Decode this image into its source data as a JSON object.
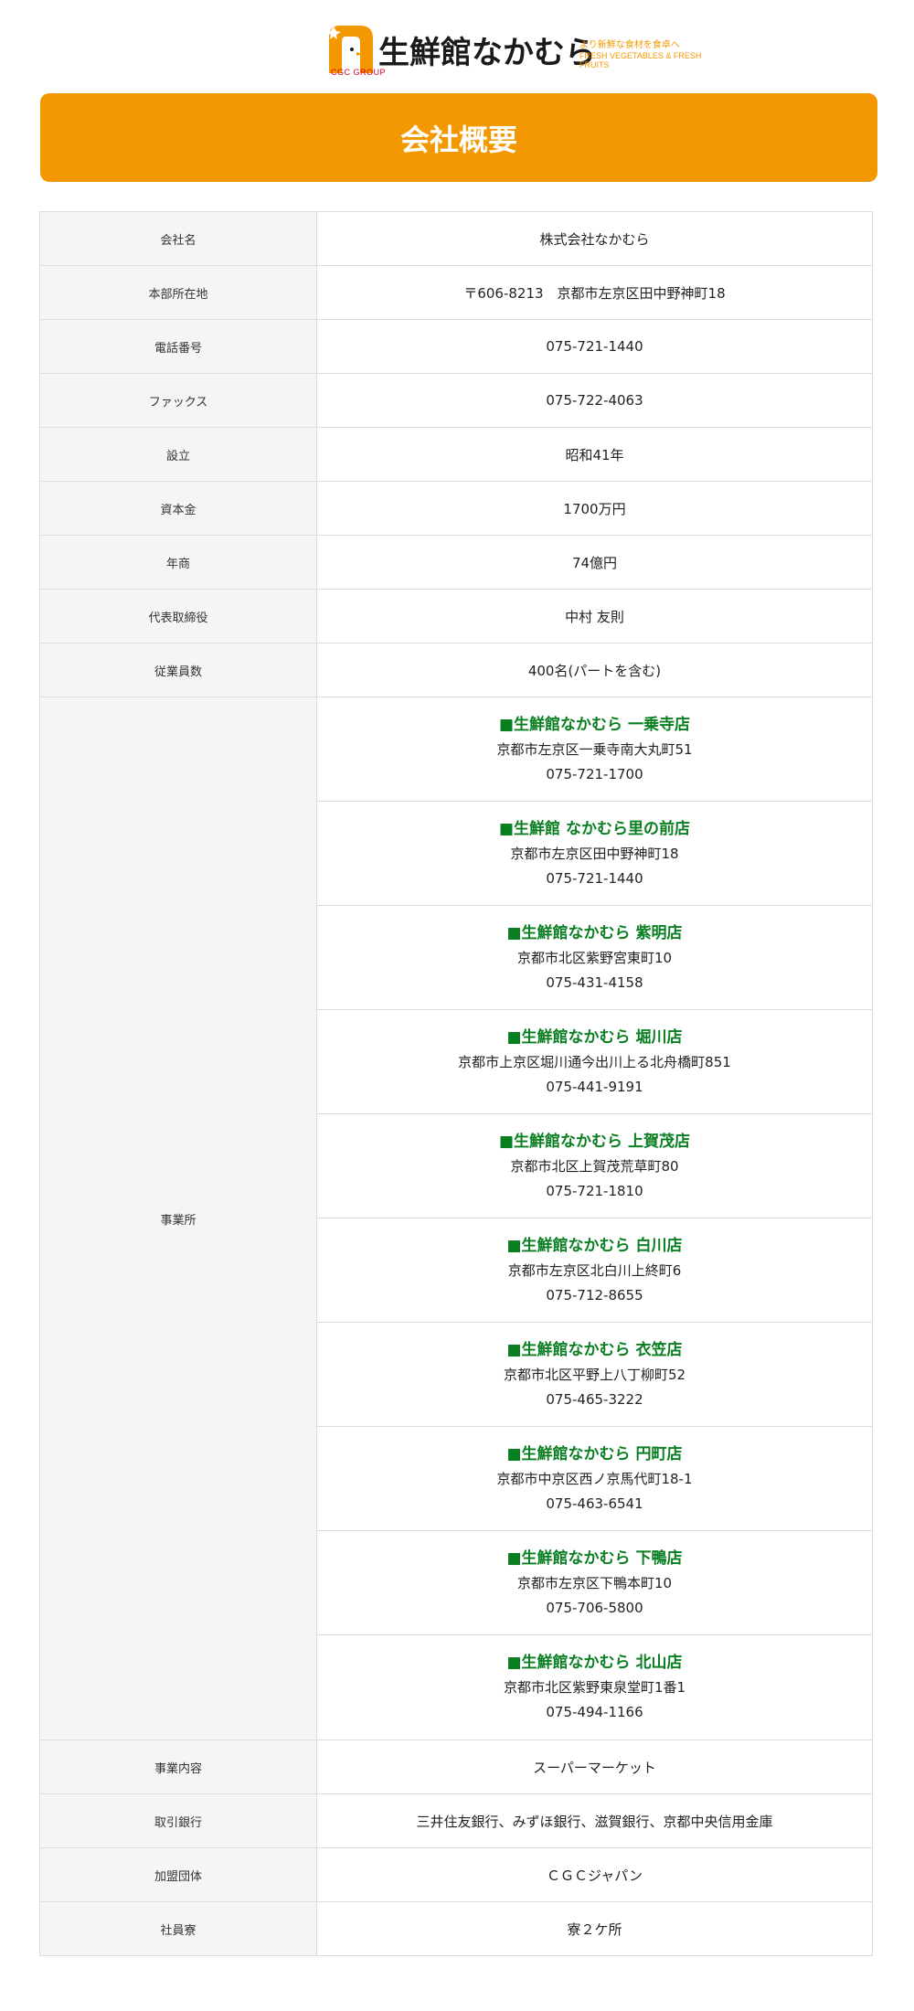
{
  "logo": {
    "name": "生鮮館なかむら",
    "group": "CGC GROUP",
    "tagline": "より新鮮な食材を食卓へ",
    "tagline_en": "FRESH VEGETABLES & FRESH FRUITS",
    "brand_color": "#f39800"
  },
  "page_title": "会社概要",
  "rows_top": [
    {
      "label": "会社名",
      "value": "株式会社なかむら"
    },
    {
      "label": "本部所在地",
      "value": "〒606-8213　京都市左京区田中野神町18"
    },
    {
      "label": "電話番号",
      "value": "075-721-1440"
    },
    {
      "label": "ファックス",
      "value": "075-722-4063"
    },
    {
      "label": "設立",
      "value": "昭和41年"
    },
    {
      "label": "資本金",
      "value": "1700万円"
    },
    {
      "label": "年商",
      "value": "74億円"
    },
    {
      "label": "代表取締役",
      "value": "中村 友則"
    },
    {
      "label": "従業員数",
      "value": "400名(パートを含む)"
    }
  ],
  "offices": {
    "label": "事業所",
    "stores": [
      {
        "name": "■生鮮館なかむら 一乗寺店",
        "address": "京都市左京区一乗寺南大丸町51",
        "tel": "075-721-1700"
      },
      {
        "name": "■生鮮館 なかむら里の前店",
        "address": "京都市左京区田中野神町18",
        "tel": "075-721-1440"
      },
      {
        "name": "■生鮮館なかむら 紫明店",
        "address": "京都市北区紫野宮東町10",
        "tel": "075-431-4158"
      },
      {
        "name": "■生鮮館なかむら 堀川店",
        "address": "京都市上京区堀川通今出川上る北舟橋町851",
        "tel": "075-441-9191"
      },
      {
        "name": "■生鮮館なかむら 上賀茂店",
        "address": "京都市北区上賀茂荒草町80",
        "tel": "075-721-1810"
      },
      {
        "name": "■生鮮館なかむら 白川店",
        "address": "京都市左京区北白川上終町6",
        "tel": "075-712-8655"
      },
      {
        "name": "■生鮮館なかむら 衣笠店",
        "address": "京都市北区平野上八丁柳町52",
        "tel": "075-465-3222"
      },
      {
        "name": "■生鮮館なかむら 円町店",
        "address": "京都市中京区西ノ京馬代町18-1",
        "tel": "075-463-6541"
      },
      {
        "name": "■生鮮館なかむら 下鴨店",
        "address": "京都市左京区下鴨本町10",
        "tel": "075-706-5800"
      },
      {
        "name": "■生鮮館なかむら 北山店",
        "address": "京都市北区紫野東泉堂町1番1",
        "tel": "075-494-1166"
      }
    ]
  },
  "rows_bottom": [
    {
      "label": "事業内容",
      "value": "スーパーマーケット"
    },
    {
      "label": "取引銀行",
      "value": "三井住友銀行、みずほ銀行、滋賀銀行、京都中央信用金庫"
    },
    {
      "label": "加盟団体",
      "value": "ＣＧＣジャパン"
    },
    {
      "label": "社員寮",
      "value": "寮２ケ所"
    }
  ]
}
